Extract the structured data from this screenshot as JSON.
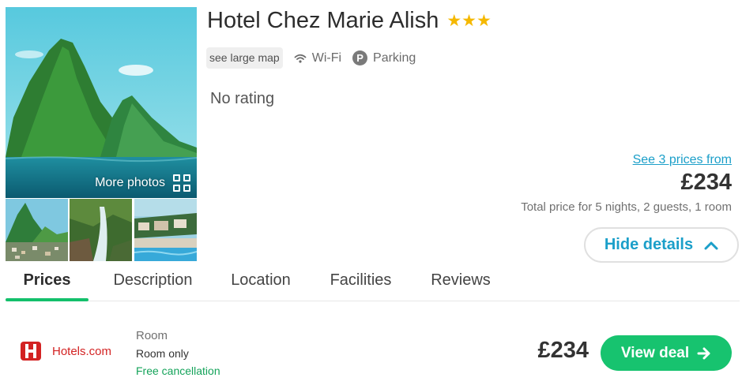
{
  "hotel": {
    "name": "Hotel Chez Marie Alish",
    "stars": "★★★",
    "map_label": "see large map",
    "amenities": [
      {
        "label": "Wi-Fi",
        "icon": "wifi-icon"
      },
      {
        "label": "Parking",
        "icon": "parking-icon",
        "glyph": "P"
      }
    ],
    "rating": "No rating"
  },
  "photos": {
    "more_label": "More photos",
    "main": "mountain-lake-photo",
    "thumbs": [
      "pitons-town-photo",
      "waterfall-photo",
      "pool-resort-photo"
    ]
  },
  "pricing": {
    "see_prices": "See 3 prices from",
    "price": "£234",
    "total_note": "Total price for 5 nights, 2 guests, 1 room",
    "hide_details": "Hide details"
  },
  "tabs": [
    {
      "label": "Prices",
      "active": true
    },
    {
      "label": "Description",
      "active": false
    },
    {
      "label": "Location",
      "active": false
    },
    {
      "label": "Facilities",
      "active": false
    },
    {
      "label": "Reviews",
      "active": false
    }
  ],
  "deal": {
    "provider": "Hotels.com",
    "room_type": "Room",
    "board": "Room only",
    "cancellation": "Free cancellation",
    "price": "£234",
    "cta": "View deal"
  },
  "colors": {
    "accent_blue": "#1b9fc9",
    "green": "#17c36f",
    "star": "#f5b800",
    "provider_red": "#d32323"
  }
}
